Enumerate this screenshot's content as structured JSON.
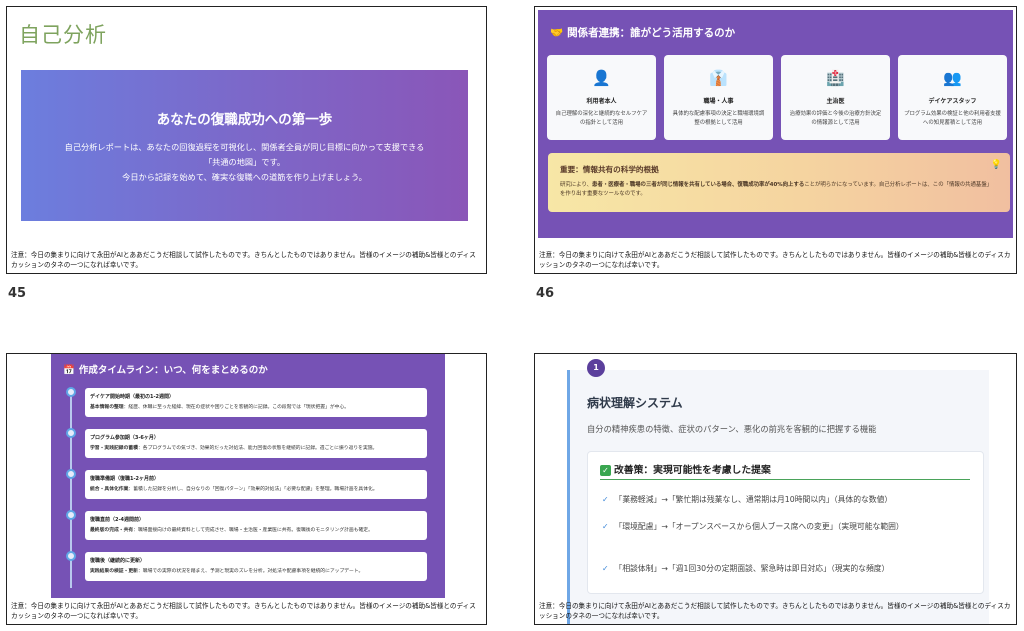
{
  "footer_note": "注意：今日の集まりに向けて永田がAIとああだこうだ相談して試作したものです。きちんとしたものではありません。皆様のイメージの補助&皆様とのディスカッションのタネの一つになれば幸いです。",
  "page_numbers": {
    "p45": "45",
    "p46": "46"
  },
  "slide45": {
    "title": "自己分析",
    "hero_heading": "あなたの復職成功への第一歩",
    "hero_line1": "自己分析レポートは、あなたの回復過程を可視化し、関係者全員が同じ目標に向かって支援できる",
    "hero_line2": "「共通の地図」です。",
    "hero_line3": "今日から記録を始めて、確実な復職への道筋を作り上げましょう。"
  },
  "slide46": {
    "title": "関係者連携：誰がどう活用するのか",
    "cards": [
      {
        "icon": "person-icon",
        "glyph": "👤",
        "name": "利用者本人",
        "desc": "自己理解の深化と継続的なセルフケアの指針として活用"
      },
      {
        "icon": "worker-icon",
        "glyph": "👔",
        "name": "職場・人事",
        "desc": "具体的な配慮事項の決定と職場環境調整の根拠として活用"
      },
      {
        "icon": "hospital-icon",
        "glyph": "🏥",
        "name": "主治医",
        "desc": "治療効果の評価と今後の治療方針決定の情報源として活用"
      },
      {
        "icon": "staff-icon",
        "glyph": "👥",
        "name": "デイケアスタッフ",
        "desc": "プログラム効果の検証と他の利用者支援への知見蓄積として活用"
      }
    ],
    "evidence_heading": "重要：情報共有の科学的根拠",
    "evidence_body_pre": "研究により、",
    "evidence_body_bold": "患者・医療者・職場の三者が同じ情報を共有している場合、復職成功率が40%向上する",
    "evidence_body_post": "ことが明らかになっています。自己分析レポートは、この「情報の共通基盤」を作り出す重要なツールなのです。"
  },
  "slide47": {
    "title": "作成タイムライン：いつ、何をまとめるのか",
    "items": [
      {
        "head": "デイケア開始時期（最初の1-2週間）",
        "label": "基本情報の整理",
        "body": "：経歴、休職に至った経緯、現在の症状や困りごとを客観的に記録。この段階では「現状把握」が中心。"
      },
      {
        "head": "プログラム参加期（3-6ヶ月）",
        "label": "学習・実践記録の蓄積",
        "body": "：各プログラムでの気づき、効果的だった対処法、能力回復の状態を継続的に記録。週ごとに振り返りを実施。"
      },
      {
        "head": "復職準備期（復職1-2ヶ月前）",
        "label": "統合・具体化作業",
        "body": "：蓄積した記録を分析し、自分なりの「回復パターン」「効果的対処法」「必要な配慮」を整理。職場計画を具体化。"
      },
      {
        "head": "復職直前（2-4週間前）",
        "label": "最終版の完成・共有",
        "body": "：職場面接向けの最終資料として完成させ、職場・主治医・産業医に共有。復職後のモニタリング計画も確定。"
      },
      {
        "head": "復職後（継続的に更新）",
        "label": "実践結果の検証・更新",
        "body": "：職場での実際の状況を踏まえ、予測と現実のズレを分析。対処法や配慮事項を継続的にアップデート。"
      }
    ]
  },
  "slide48": {
    "badge": "1",
    "title": "病状理解システム",
    "description": "自分の精神疾患の特徴、症状のパターン、悪化の前兆を客観的に把握する機能",
    "improvement_heading": "改善策：実現可能性を考慮した提案",
    "improvements": [
      "「業務軽減」→「繁忙期は残業なし、通常期は月10時間以内」（具体的な数値）",
      "「環境配慮」→「オープンスペースから個人ブース席への変更」（実現可能な範囲）",
      "「相談体制」→「週1回30分の定期面談、緊急時は即日対応」（現実的な頻度）"
    ]
  }
}
